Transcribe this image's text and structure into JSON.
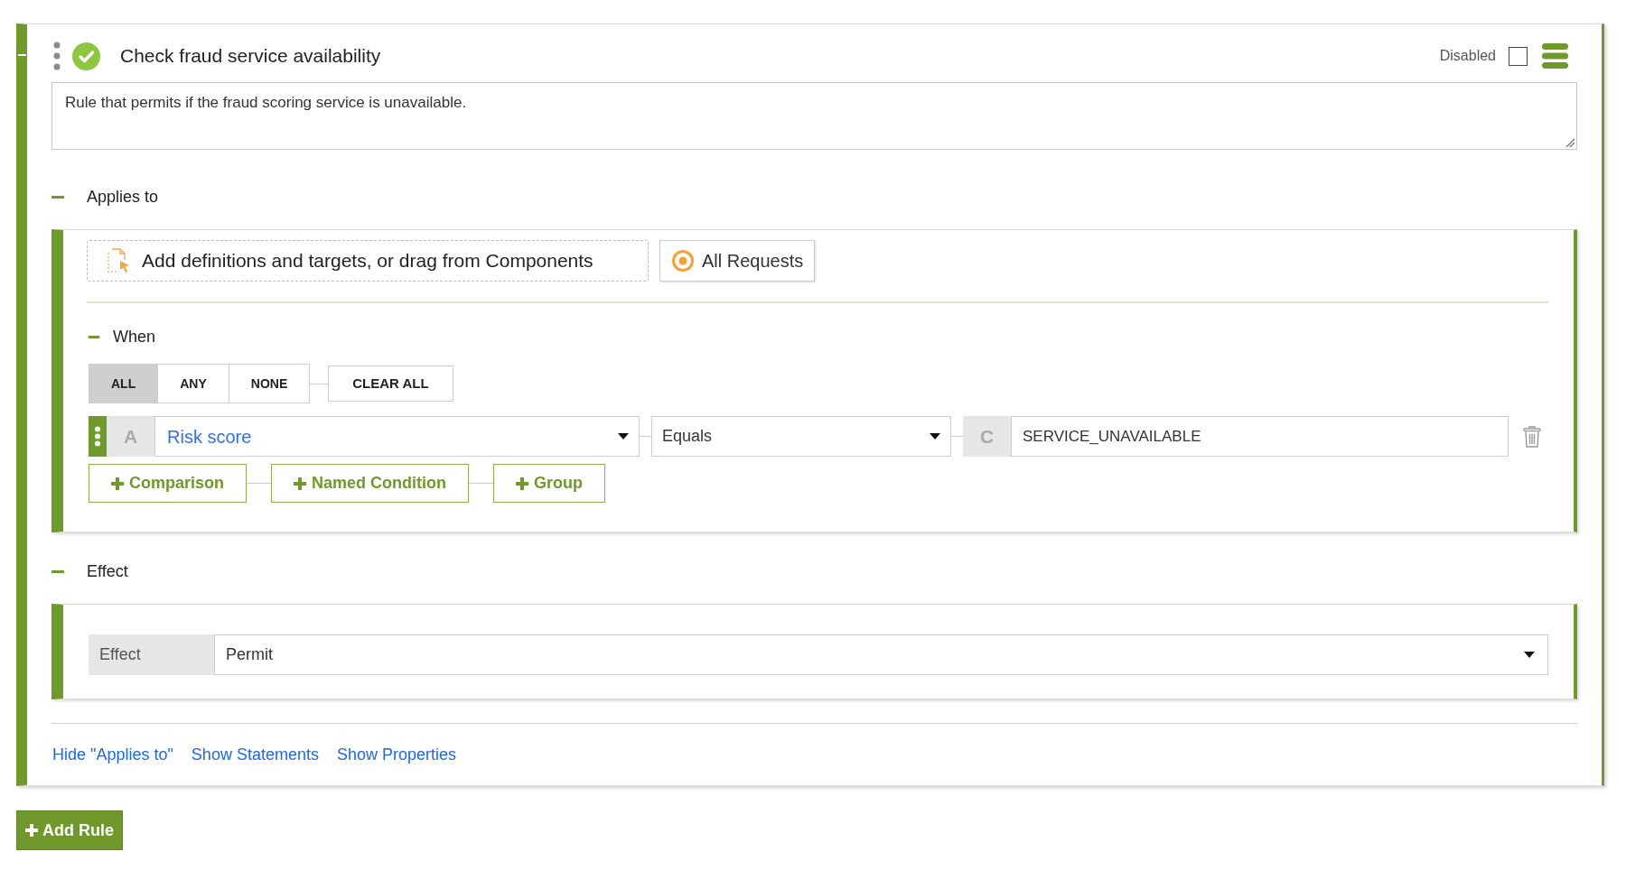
{
  "rule": {
    "title": "Check fraud service availability",
    "disabled": {
      "label": "Disabled",
      "checked": false
    },
    "description": "Rule that permits if the fraud scoring service is unavailable.",
    "applies_to": {
      "heading": "Applies to",
      "expanded": true,
      "add_targets_button": "Add definitions and targets, or drag from Components",
      "target_option": {
        "label": "All Requests",
        "selected": true
      },
      "when": {
        "heading": "When",
        "expanded": true,
        "combinators": [
          {
            "label": "ALL",
            "selected": true
          },
          {
            "label": "ANY",
            "selected": false
          },
          {
            "label": "NONE",
            "selected": false
          }
        ],
        "clear_button": "CLEAR ALL",
        "conditions": [
          {
            "left_tag": "A",
            "attribute": "Risk score",
            "operator": "Equals",
            "right_tag": "C",
            "value": "SERVICE_UNAVAILABLE"
          }
        ],
        "add_buttons": [
          "Comparison",
          "Named Condition",
          "Group"
        ]
      }
    },
    "effect": {
      "heading": "Effect",
      "expanded": true,
      "label": "Effect",
      "value": "Permit"
    },
    "links": [
      "Hide \"Applies to\"",
      "Show Statements",
      "Show Properties"
    ]
  },
  "add_rule_button": "Add Rule"
}
